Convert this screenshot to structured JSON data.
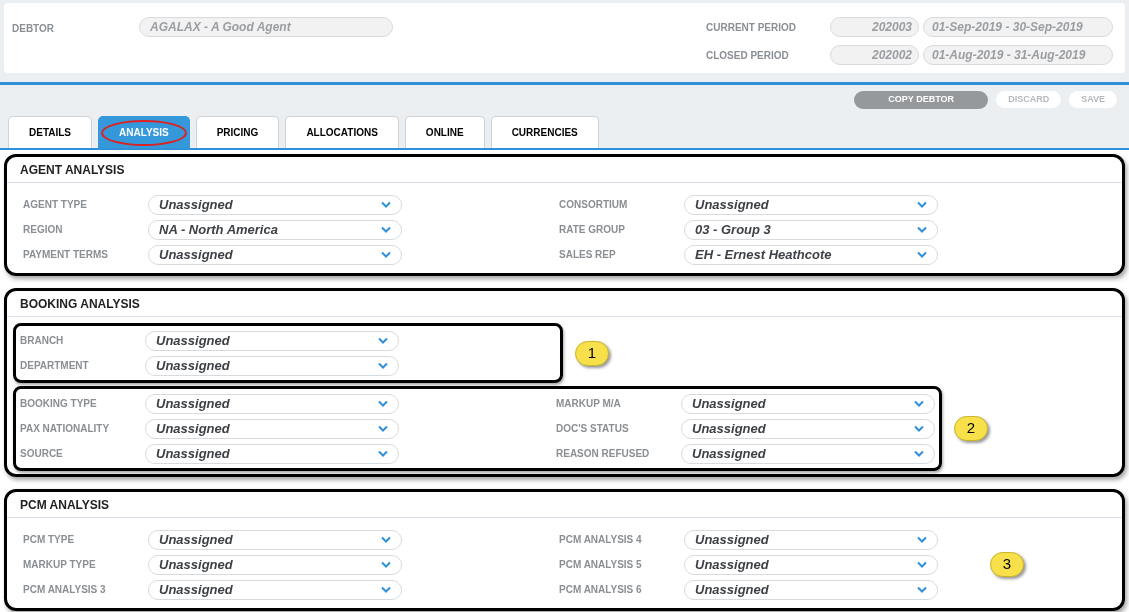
{
  "debtor": {
    "label": "DEBTOR",
    "value": "AGALAX - A Good Agent"
  },
  "periods": [
    {
      "label": "CURRENT PERIOD",
      "code": "202003",
      "range": "01-Sep-2019 - 30-Sep-2019"
    },
    {
      "label": "CLOSED PERIOD",
      "code": "202002",
      "range": "01-Aug-2019 - 31-Aug-2019"
    }
  ],
  "actions": [
    {
      "label": "COPY DEBTOR",
      "disabled": false
    },
    {
      "label": "DISCARD",
      "disabled": true
    },
    {
      "label": "SAVE",
      "disabled": true
    }
  ],
  "tabs": [
    {
      "label": "DETAILS",
      "selected": false,
      "circled": false
    },
    {
      "label": "ANALYSIS",
      "selected": true,
      "circled": true
    },
    {
      "label": "PRICING",
      "selected": false,
      "circled": false
    },
    {
      "label": "ALLOCATIONS",
      "selected": false,
      "circled": false
    },
    {
      "label": "ONLINE",
      "selected": false,
      "circled": false
    },
    {
      "label": "CURRENCIES",
      "selected": false,
      "circled": false
    }
  ],
  "sections": [
    {
      "title": "AGENT ANALYSIS",
      "groups": [
        {
          "boxed": false,
          "left": [
            {
              "label": "AGENT TYPE",
              "value": "Unassigned"
            },
            {
              "label": "REGION",
              "value": "NA - North America"
            },
            {
              "label": "PAYMENT TERMS",
              "value": "Unassigned"
            }
          ],
          "right": [
            {
              "label": "CONSORTIUM",
              "value": "Unassigned"
            },
            {
              "label": "RATE GROUP",
              "value": "03 - Group 3"
            },
            {
              "label": "SALES REP",
              "value": "EH - Ernest Heathcote"
            }
          ]
        }
      ]
    },
    {
      "title": "BOOKING ANALYSIS",
      "groups": [
        {
          "boxed": true,
          "marker": "1",
          "left": [
            {
              "label": "BRANCH",
              "value": "Unassigned"
            },
            {
              "label": "DEPARTMENT",
              "value": "Unassigned"
            }
          ]
        },
        {
          "boxed": true,
          "marker": "2",
          "left": [
            {
              "label": "BOOKING TYPE",
              "value": "Unassigned"
            },
            {
              "label": "PAX NATIONALITY",
              "value": "Unassigned"
            },
            {
              "label": "SOURCE",
              "value": "Unassigned"
            }
          ],
          "right": [
            {
              "label": "MARKUP M/A",
              "value": "Unassigned"
            },
            {
              "label": "DOC'S STATUS",
              "value": "Unassigned"
            },
            {
              "label": "REASON REFUSED",
              "value": "Unassigned"
            }
          ]
        }
      ]
    },
    {
      "title": "PCM ANALYSIS",
      "groups": [
        {
          "boxed": false,
          "marker": "3",
          "left": [
            {
              "label": "PCM TYPE",
              "value": "Unassigned"
            },
            {
              "label": "MARKUP TYPE",
              "value": "Unassigned"
            },
            {
              "label": "PCM ANALYSIS 3",
              "value": "Unassigned"
            }
          ],
          "right": [
            {
              "label": "PCM ANALYSIS 4",
              "value": "Unassigned"
            },
            {
              "label": "PCM ANALYSIS 5",
              "value": "Unassigned"
            },
            {
              "label": "PCM ANALYSIS 6",
              "value": "Unassigned"
            }
          ]
        }
      ]
    }
  ]
}
